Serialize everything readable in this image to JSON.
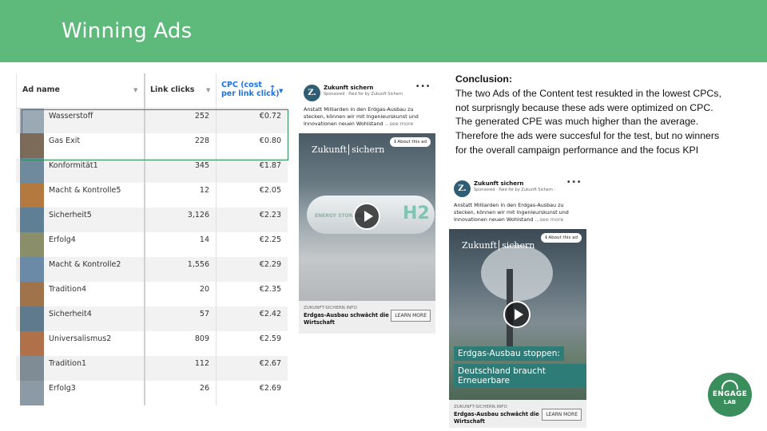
{
  "slide": {
    "title": "Winning Ads"
  },
  "table": {
    "columns": {
      "name": "Ad name",
      "clicks": "Link clicks",
      "cpc_line1": "CPC (cost",
      "cpc_line2": "per link click)"
    },
    "rows": [
      {
        "name": "Wasserstoff",
        "clicks": "252",
        "cpc": "€0.72"
      },
      {
        "name": "Gas Exit",
        "clicks": "228",
        "cpc": "€0.80"
      },
      {
        "name": "Konformität1",
        "clicks": "345",
        "cpc": "€1.87"
      },
      {
        "name": "Macht & Kontrolle5",
        "clicks": "12",
        "cpc": "€2.05"
      },
      {
        "name": "Sicherheit5",
        "clicks": "3,126",
        "cpc": "€2.23"
      },
      {
        "name": "Erfolg4",
        "clicks": "14",
        "cpc": "€2.25"
      },
      {
        "name": "Macht & Kontrolle2",
        "clicks": "1,556",
        "cpc": "€2.29"
      },
      {
        "name": "Tradition4",
        "clicks": "20",
        "cpc": "€2.35"
      },
      {
        "name": "Sicherheit4",
        "clicks": "57",
        "cpc": "€2.42"
      },
      {
        "name": "Universalismus2",
        "clicks": "809",
        "cpc": "€2.59"
      },
      {
        "name": "Tradition1",
        "clicks": "112",
        "cpc": "€2.67"
      },
      {
        "name": "Erfolg3",
        "clicks": "26",
        "cpc": "€2.69"
      }
    ]
  },
  "ad1": {
    "logo_letter": "Z.",
    "brand": "Zukunft sichern",
    "sponsored": "Sponsored · Paid for by Zukunft Sichern",
    "dots": "•••",
    "text": "Anstatt Milliarden in den Erdgas-Ausbau zu stecken, können wir mit Ingenieurskunst und Innovationen neuen Wohlstand",
    "see_more": "...see more",
    "wordmark_a": "Zukunft",
    "wordmark_b": "sichern",
    "about": "About this ad",
    "about_icon": "i",
    "tank_label": "ENERGY STORAGE",
    "tank_h2": "H2",
    "domain": "ZUKUNFT-SICHERN.INFO",
    "headline": "Erdgas-Ausbau schwächt die Wirtschaft",
    "cta": "LEARN MORE"
  },
  "ad2": {
    "logo_letter": "Z.",
    "brand": "Zukunft sichern",
    "sponsored": "Sponsored · Paid for by Zukunft Sichern ·",
    "dots": "•••",
    "text": "Anstatt Milliarden in den Erdgas-Ausbau zu stecken, können wir mit Ingenieurskunst und Innovationen neuen Wohlstand",
    "see_more": "...see more",
    "wordmark_a": "Zukunft",
    "wordmark_b": "sichern",
    "about": "About this ad",
    "about_icon": "i",
    "banner1": "Erdgas-Ausbau stoppen:",
    "banner2": "Deutschland braucht Erneuerbare",
    "domain": "ZUKUNFT-SICHERN.INFO",
    "headline": "Erdgas-Ausbau schwächt die Wirtschaft",
    "cta": "LEARN MORE"
  },
  "conclusion": {
    "heading": "Conclusion:",
    "text": "The two Ads of the Content test resukted in the lowest CPCs, not surprisngly because these ads were optimized on CPC. The generated CPE was much higher than the average. Therefore the ads were succesful for the test, but no winners for the overall campaign performance and the focus KPI"
  },
  "badge": {
    "line1": "ENGAGE",
    "line2": "LAB"
  },
  "colors": {
    "header": "#5dba7a",
    "accent_blue": "#1a73e8",
    "highlight": "#2e8b57",
    "badge": "#3a8e5c"
  }
}
